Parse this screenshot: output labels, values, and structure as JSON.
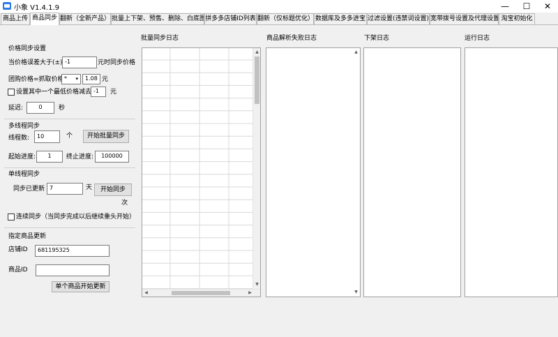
{
  "window": {
    "title": "小象 V1.4.1.9",
    "controls": [
      "—",
      "☐",
      "✕"
    ]
  },
  "tabs": [
    {
      "label": "商品上传",
      "active": false
    },
    {
      "label": "商品同步",
      "active": true
    },
    {
      "label": "翻新（全新产品）",
      "active": false
    },
    {
      "label": "批量上下架、预售、删除、白底图",
      "active": false
    },
    {
      "label": "拼多多店铺ID列表",
      "active": false
    },
    {
      "label": "翻新（仅标题优化）",
      "active": false
    },
    {
      "label": "数据库及多多进宝",
      "active": false
    },
    {
      "label": "过滤设置(违禁词设置)",
      "active": false
    },
    {
      "label": "宽带拨号设置及代理设置",
      "active": false
    },
    {
      "label": "淘宝初始化",
      "active": false
    }
  ],
  "price_sync": {
    "section_title": "价格同步设置",
    "diff_label": "当价格误差大于(±)",
    "diff_value": "-1",
    "diff_suffix": "元时同步价格",
    "group_label": "团购价格=抓取价格",
    "operator": "*",
    "multiplier": "1.08",
    "multiplier_unit": "元",
    "subtract_label": "设置其中一个最低价格减去",
    "subtract_value": "-1",
    "subtract_unit": "元",
    "delay_label": "延迟:",
    "delay_value": "0",
    "delay_unit": "秒"
  },
  "multi_thread": {
    "section_title": "多线程同步",
    "threads_label": "线程数:",
    "threads_value": "10",
    "threads_unit": "个",
    "start_button": "开始批量同步",
    "start_progress_label": "起始进度:",
    "start_progress_value": "1",
    "end_progress_label": "终止进度:",
    "end_progress_value": "100000"
  },
  "single_thread": {
    "section_title": "单线程同步",
    "updated_label": "同步已更新",
    "updated_value": "7",
    "updated_unit": "天",
    "start_button": "开始同步",
    "times_unit": "次",
    "continuous_label": "连续同步（当同步完成以后继续重头开始）"
  },
  "specific": {
    "section_title": "指定商品更新",
    "shop_id_label": "店铺ID",
    "shop_id_value": "681195325",
    "goods_id_label": "商品ID",
    "goods_id_value": "",
    "update_button": "单个商品开始更新"
  },
  "logs": {
    "batch": "批量同步日志",
    "parse_fail": "商品解析失败日志",
    "delist": "下架日志",
    "runtime": "运行日志"
  }
}
